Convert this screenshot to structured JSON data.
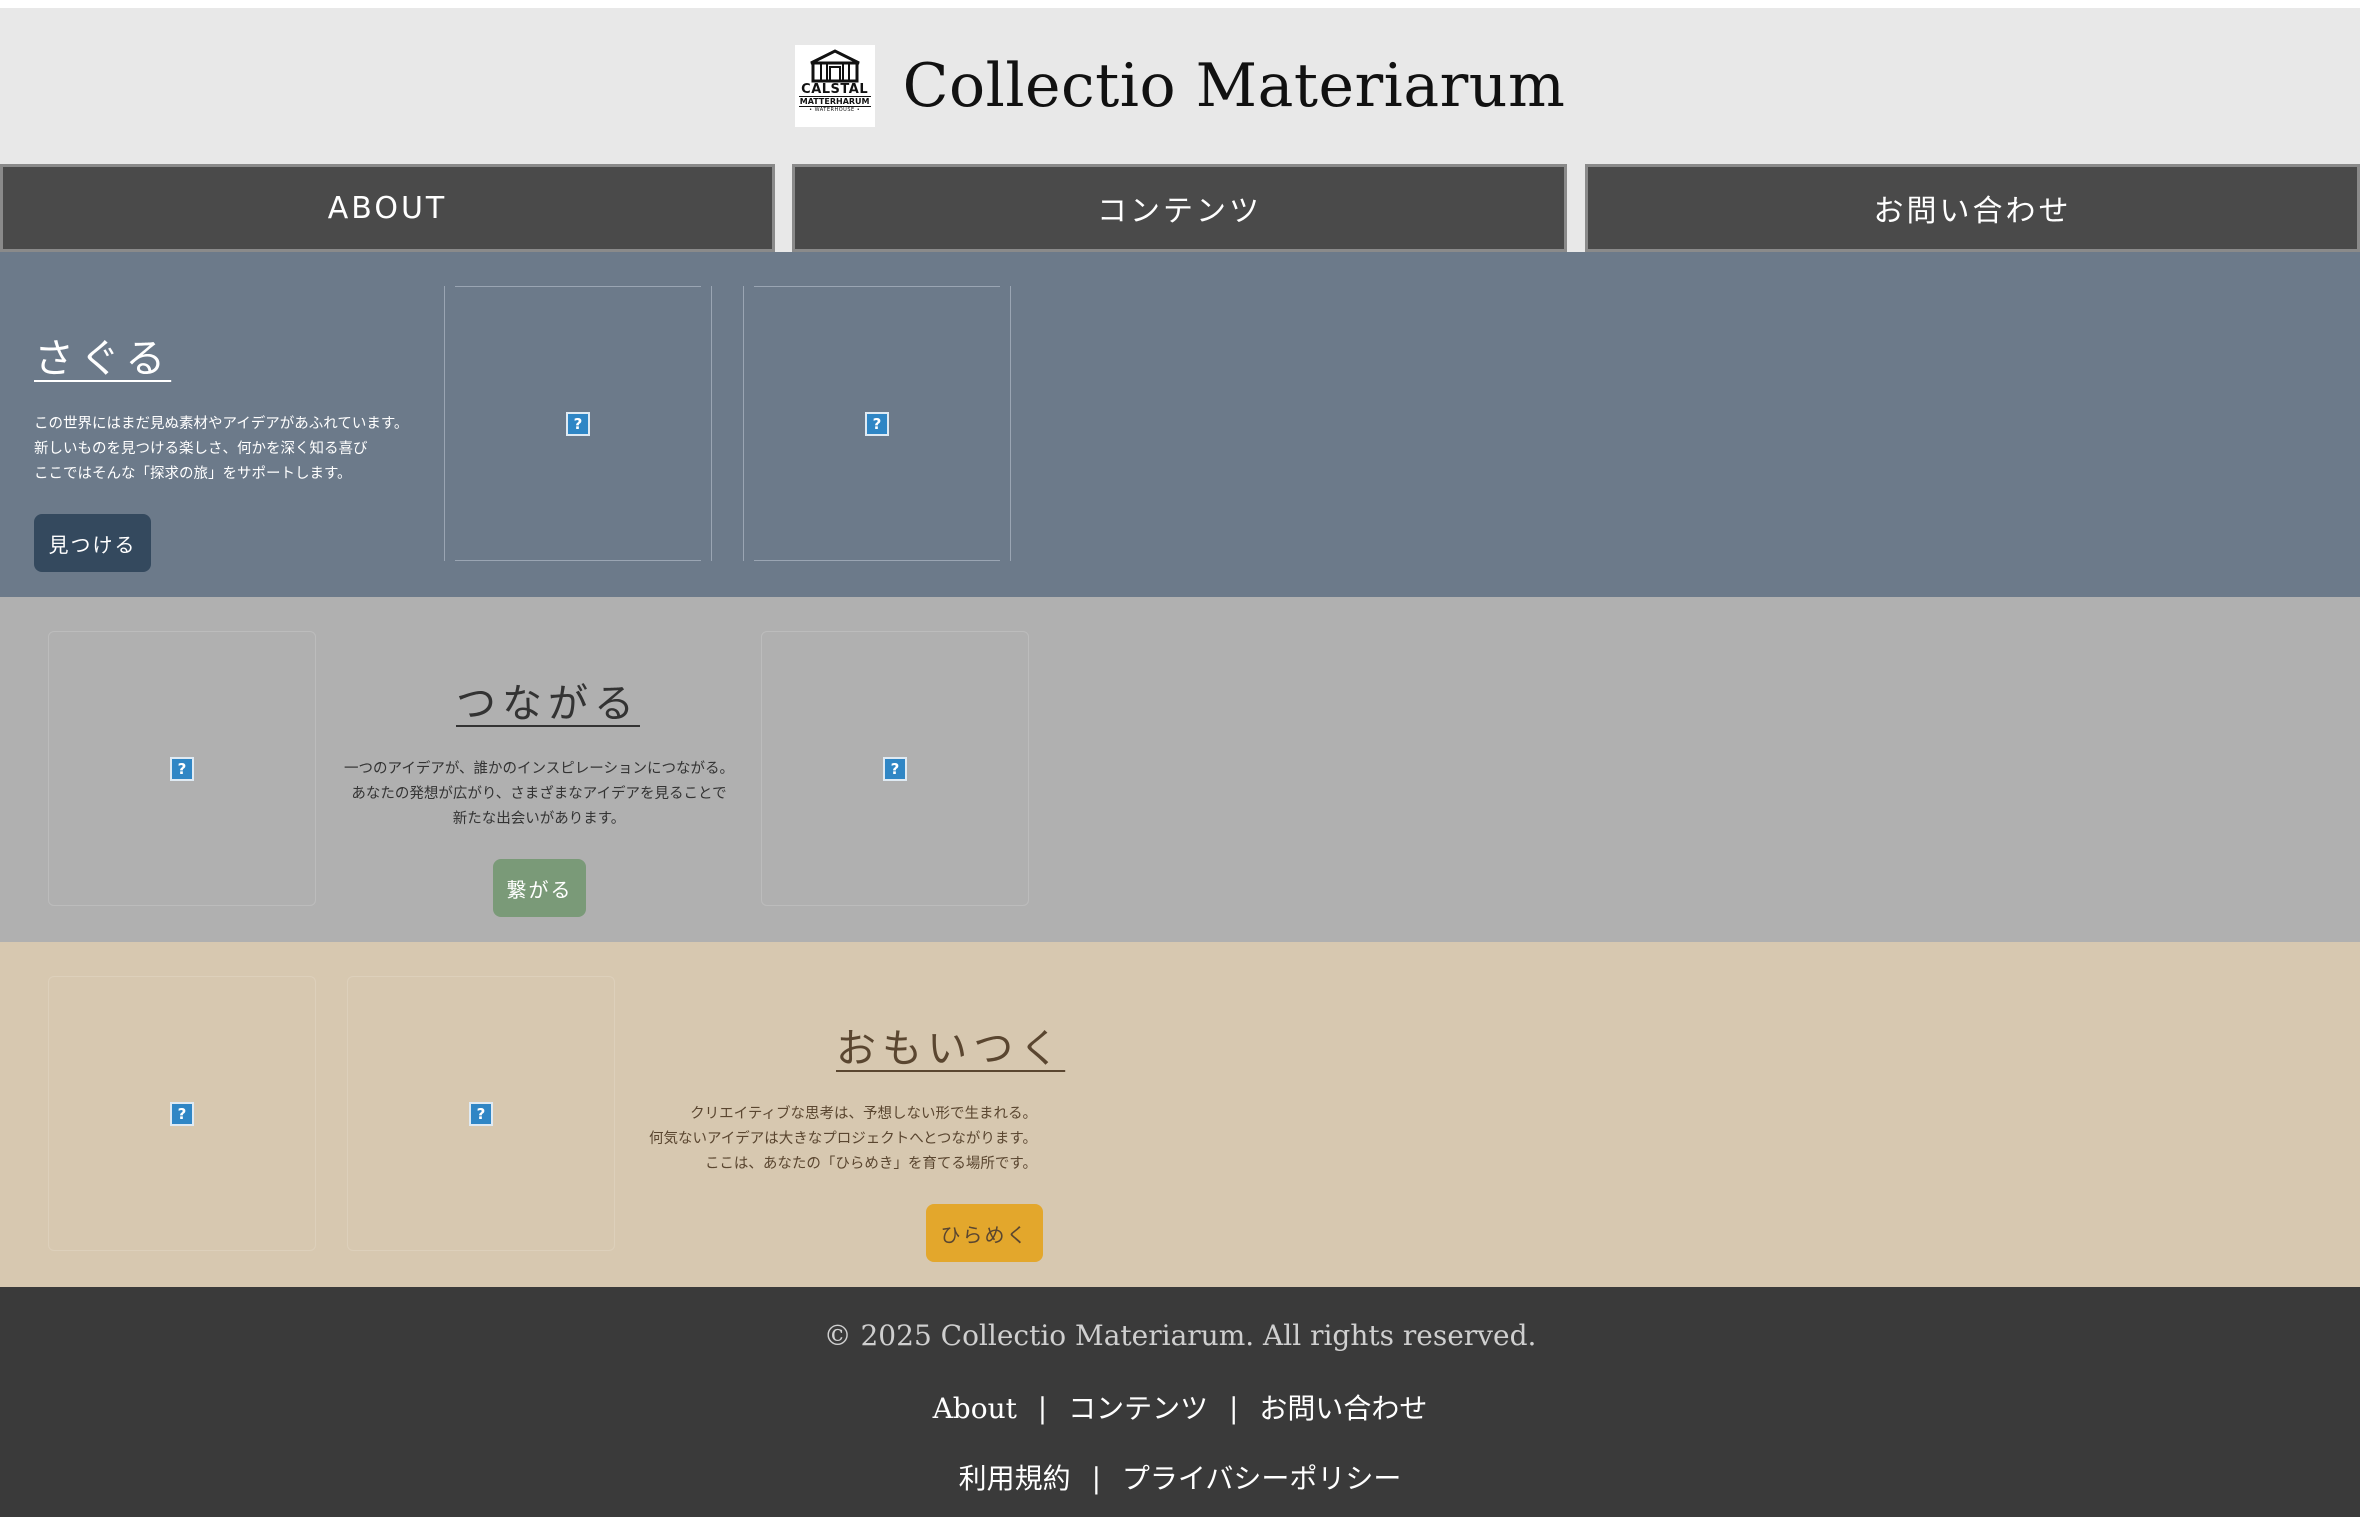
{
  "header": {
    "logo": {
      "line1": "CALSTAL",
      "line2": "MATTERHARUM",
      "line3": "• WATERHOUSE •"
    },
    "title": "Collectio Materiarum"
  },
  "nav": {
    "about": "ABOUT",
    "contents": "コンテンツ",
    "contact": "お問い合わせ"
  },
  "sections": {
    "explore": {
      "heading": "さぐる",
      "lines": [
        "この世界にはまだ見ぬ素材やアイデアがあふれています。",
        "新しいものを見つける楽しさ、何かを深く知る喜び",
        "ここではそんな「探求の旅」をサポートします。"
      ],
      "button": "見つける",
      "colors": {
        "background": "#6c7a8a",
        "button": "#34495e"
      }
    },
    "connect": {
      "heading": "つながる",
      "lines": [
        "一つのアイデアが、誰かのインスピレーションにつながる。",
        "あなたの発想が広がり、さまざまなアイデアを見ることで",
        "新たな出会いがあります。"
      ],
      "button": "繋がる",
      "colors": {
        "background": "#b0b0b0",
        "button": "#7a9a78"
      }
    },
    "inspire": {
      "heading": "おもいつく",
      "lines": [
        "クリエイティブな思考は、予想しない形で生まれる。",
        "何気ないアイデアは大きなプロジェクトへとつながります。",
        "ここは、あなたの「ひらめき」を育てる場所です。"
      ],
      "button": "ひらめく",
      "colors": {
        "background": "#d7c8b0",
        "button": "#e3a72c"
      }
    },
    "image_placeholder": "?"
  },
  "footer": {
    "copyright": "© 2025 Collectio Materiarum. All rights reserved.",
    "links": [
      "About",
      "コンテンツ",
      "お問い合わせ"
    ],
    "legal": [
      "利用規約",
      "プライバシーポリシー"
    ],
    "separator": "|"
  }
}
